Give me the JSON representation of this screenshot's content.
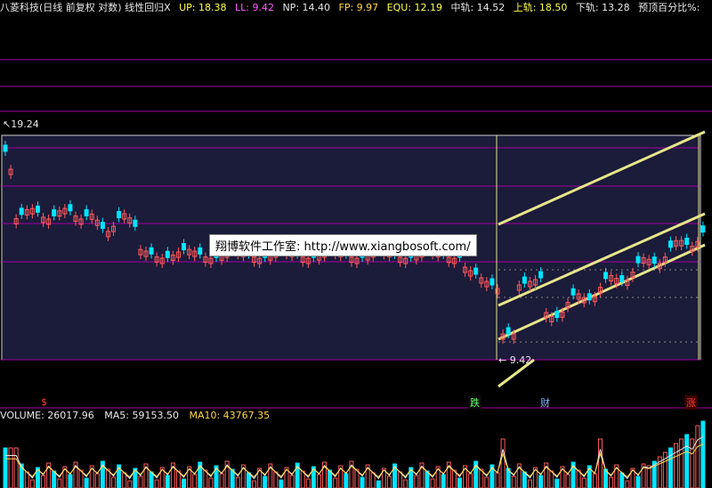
{
  "topbar": {
    "title": "八菱科技(日线 前复权 对数) 线性回归X",
    "up": "UP: 18.38",
    "ll": "LL: 9.42",
    "np": "NP: 14.40",
    "fp": "FP: 9.97",
    "equ": "EQU: 12.19",
    "mid": "中轨: 14.52",
    "upper": "上轨: 18.50",
    "lower": "下轨: 13.28",
    "pct": "预顶百分比%:"
  },
  "chart": {
    "high_label": "19.24",
    "low_label": "9.42",
    "watermark": "翔博软件工作室: http://www.xiangbosoft.com/",
    "markers": {
      "s": "$",
      "die": "跌",
      "cai": "财",
      "zhang": "涨"
    },
    "colors": {
      "up": "#ff5b5b",
      "down": "#00e5ff",
      "channel": "#e6e68a",
      "grid": "#a000a0",
      "bg": "#1b1b3a"
    }
  },
  "volume": {
    "label": "VOLUME: 26017.96",
    "ma5": "MA5: 59153.50",
    "ma10": "MA10: 43767.35"
  }
}
